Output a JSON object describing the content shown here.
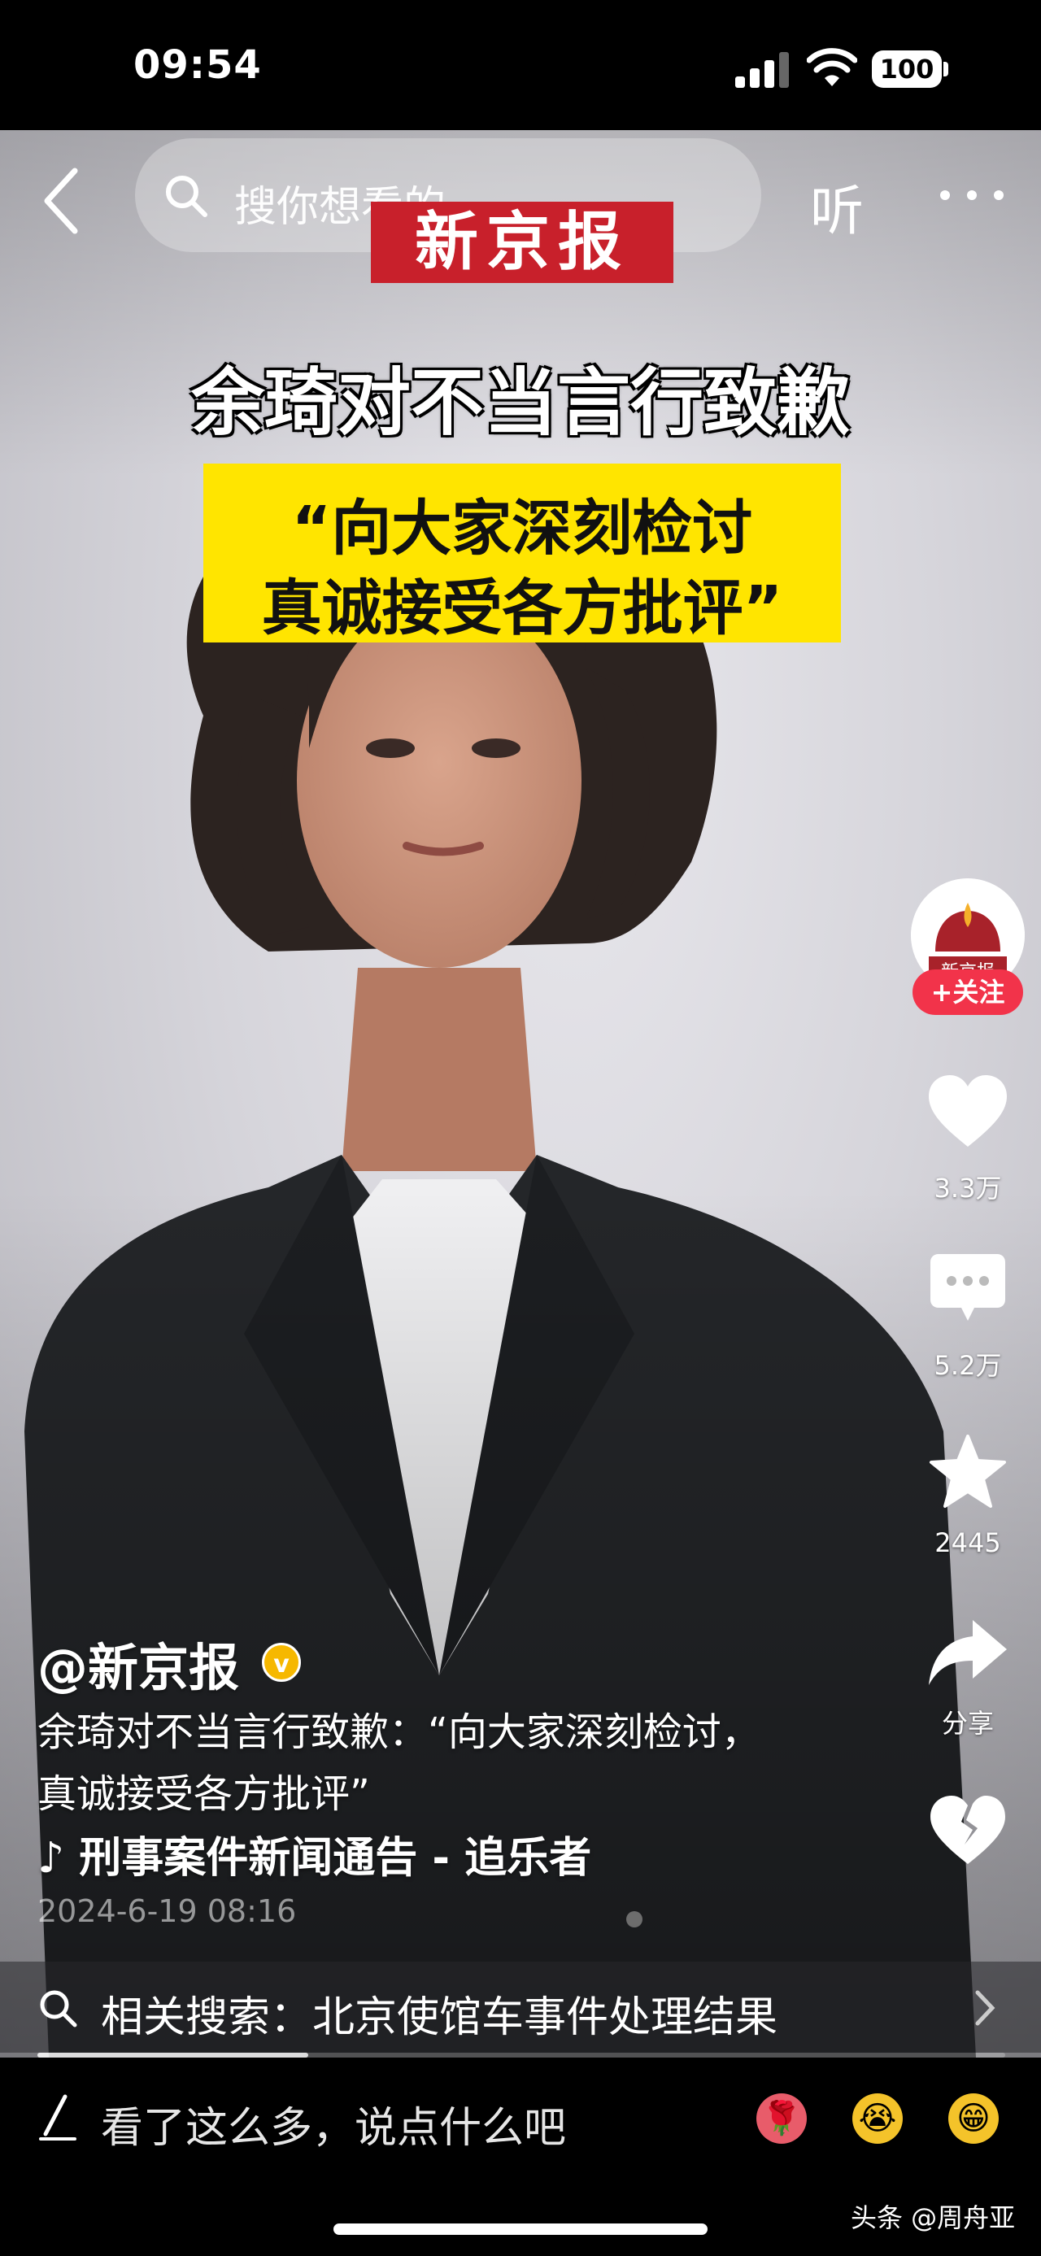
{
  "status_bar": {
    "time": "09:54",
    "battery": "100"
  },
  "top_bar": {
    "search_placeholder": "搜你想看的",
    "listen_label": "听"
  },
  "video_overlay": {
    "logo_text": "新京报",
    "headline": "余琦对不当言行致歉",
    "quote_line1": "“向大家深刻检讨",
    "quote_line2": "真诚接受各方批评”"
  },
  "actions": {
    "avatar_text": "新京报",
    "follow_label": "+关注",
    "likes": "3.3万",
    "comments": "5.2万",
    "favorites": "2445",
    "share_label": "分享"
  },
  "caption": {
    "author": "@新京报",
    "verified_mark": "v",
    "description_line1": "余琦对不当言行致歉：“向大家深刻检讨，",
    "description_line2": "真诚接受各方批评”",
    "music": "♪ 刑事案件新闻通告 - 追乐者",
    "date": "2024-6-19 08:16"
  },
  "related_search": {
    "text": "相关搜索：北京使馆车事件处理结果",
    "progress_percent": 28
  },
  "comment_bar": {
    "placeholder": "看了这么多，说点什么吧",
    "emojis": [
      "rose-emoji",
      "crying-emoji",
      "grinning-emoji"
    ]
  },
  "watermark": "头条 @周舟亚",
  "colors": {
    "follow_red": "#f2334a",
    "quote_yellow": "#ffe500",
    "logo_red": "#c8202b",
    "verified_gold": "#f6b800"
  }
}
